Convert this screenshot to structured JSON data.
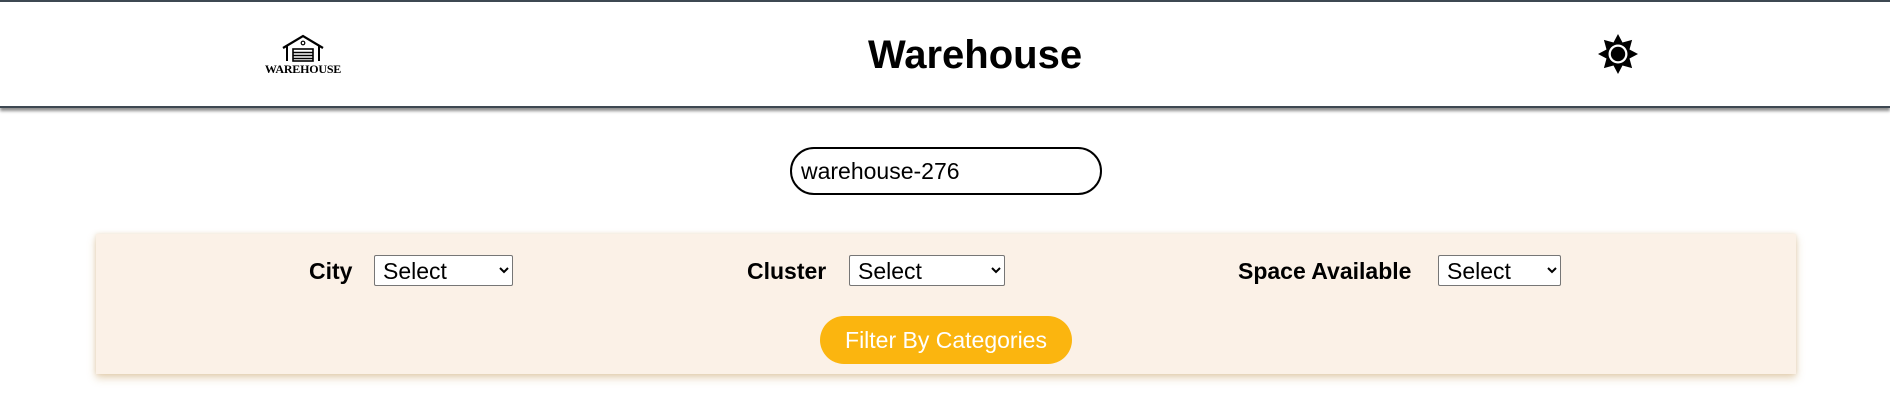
{
  "header": {
    "logo_text": "WAREHOUSE",
    "title": "Warehouse",
    "theme_icon": "sun-icon"
  },
  "search": {
    "value": "warehouse-276"
  },
  "filters": {
    "city_label": "City",
    "city_selected": "Select",
    "cluster_label": "Cluster",
    "cluster_selected": "Select",
    "space_label": "Space Available",
    "space_selected": "Select",
    "button_label": "Filter By Categories"
  },
  "colors": {
    "panel_bg": "#fbf1e7",
    "button_bg": "#fbb50f",
    "header_border": "#3e4852"
  }
}
